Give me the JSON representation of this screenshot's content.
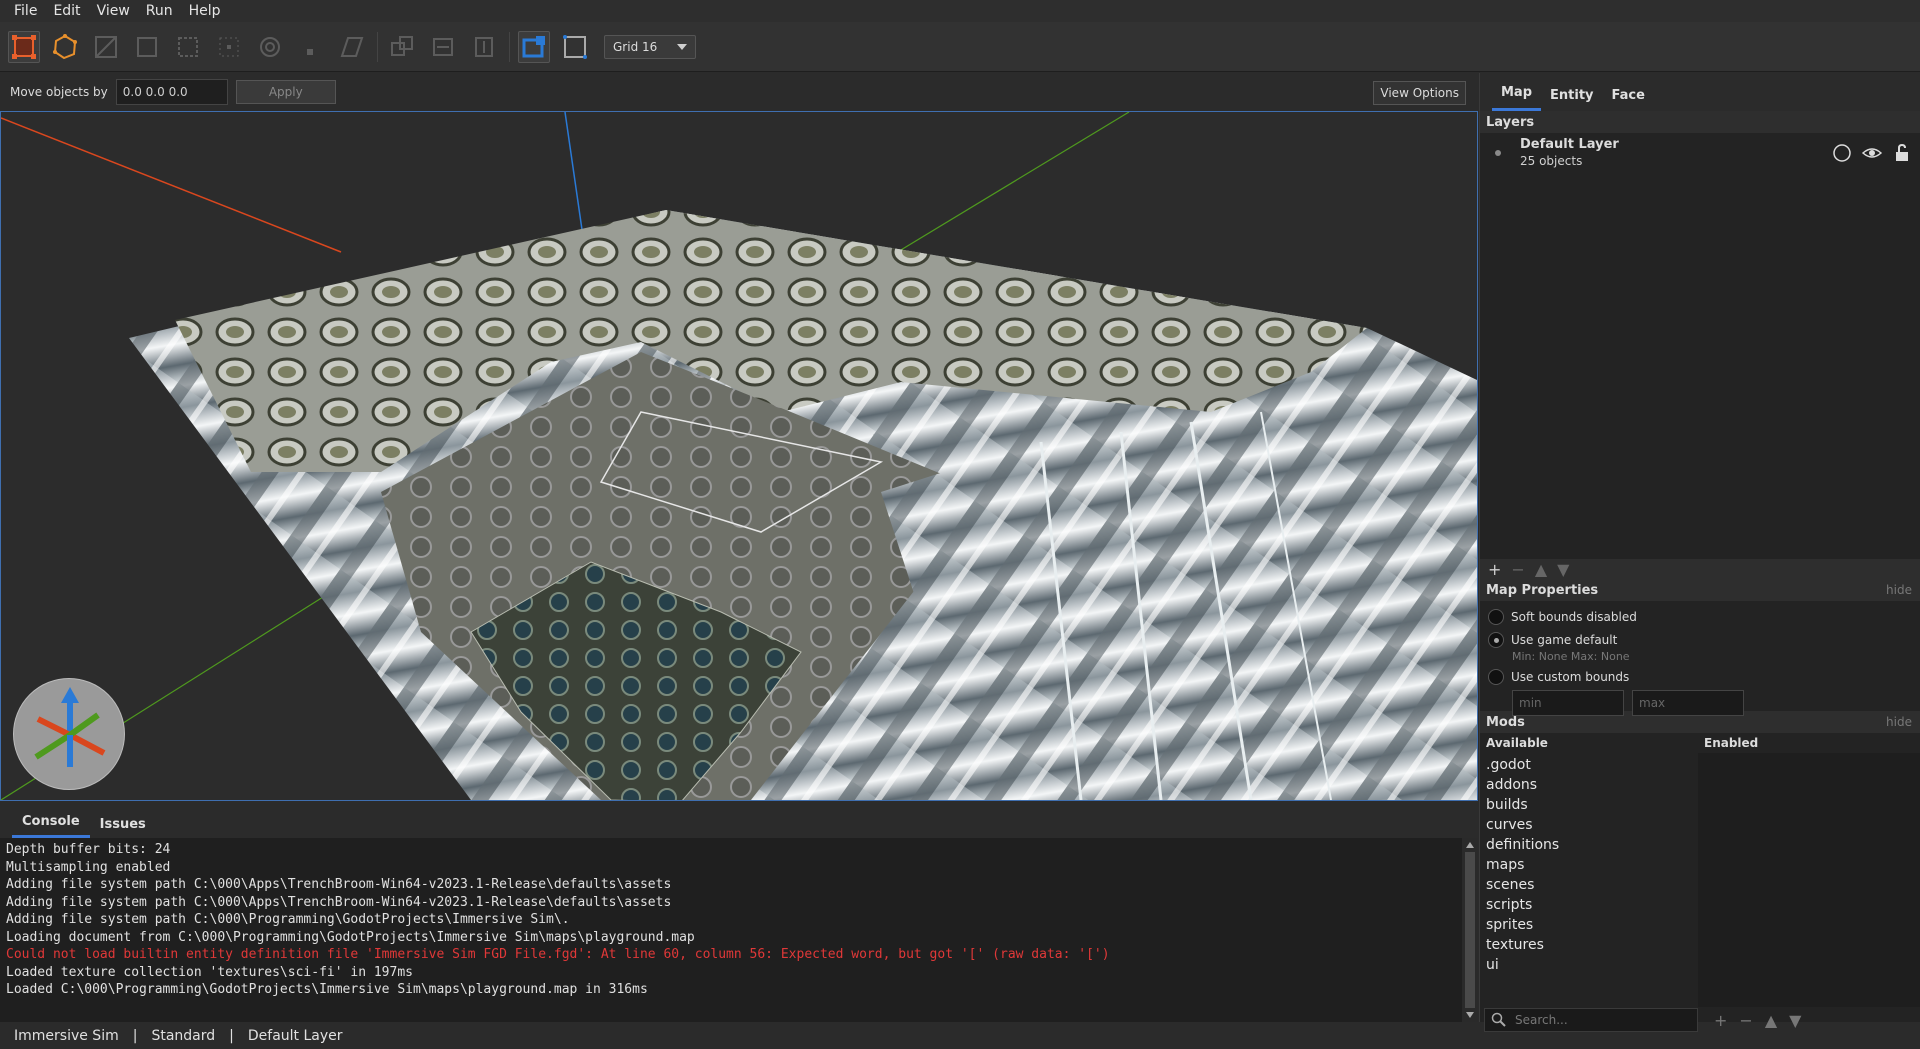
{
  "menu": [
    "File",
    "Edit",
    "View",
    "Run",
    "Help"
  ],
  "toolbar": {
    "tools": [
      "select-tool",
      "draw-brush-tool",
      "clip-tool",
      "vertex-tool",
      "edge-tool",
      "face-tool",
      "rotate-tool",
      "scale-tool",
      "shear-tool",
      "duplicate-tool",
      "flip-horizontal-tool",
      "flip-vertical-tool",
      "texture-lock-tool",
      "uv-lock-tool"
    ],
    "grid_label": "Grid 16"
  },
  "movebar": {
    "label": "Move objects by",
    "value": "0.0 0.0 0.0",
    "apply_label": "Apply",
    "view_options_label": "View Options"
  },
  "console": {
    "tabs": [
      "Console",
      "Issues"
    ],
    "lines": [
      {
        "text": "Depth buffer bits: 24",
        "error": false
      },
      {
        "text": "Multisampling enabled",
        "error": false
      },
      {
        "text": "Adding file system path C:\\000\\Apps\\TrenchBroom-Win64-v2023.1-Release\\defaults\\assets",
        "error": false
      },
      {
        "text": "Adding file system path C:\\000\\Apps\\TrenchBroom-Win64-v2023.1-Release\\defaults\\assets",
        "error": false
      },
      {
        "text": "Adding file system path C:\\000\\Programming\\GodotProjects\\Immersive Sim\\.",
        "error": false
      },
      {
        "text": "Loading document from C:\\000\\Programming\\GodotProjects\\Immersive Sim\\maps\\playground.map",
        "error": false
      },
      {
        "text": "Could not load builtin entity definition file 'Immersive Sim FGD File.fgd': At line 60, column 56: Expected word, but got '[' (raw data: '[')",
        "error": true
      },
      {
        "text": "Loaded texture collection 'textures\\sci-fi' in 197ms",
        "error": false
      },
      {
        "text": "Loaded C:\\000\\Programming\\GodotProjects\\Immersive Sim\\maps\\playground.map in 316ms",
        "error": false
      }
    ]
  },
  "status": [
    "Immersive Sim",
    "Standard",
    "Default Layer"
  ],
  "status_sep": "|",
  "inspector": {
    "tabs": [
      "Map",
      "Entity",
      "Face"
    ],
    "layers_title": "Layers",
    "layer": {
      "name": "Default Layer",
      "count": "25 objects"
    },
    "map_properties_title": "Map Properties",
    "hide_label": "hide",
    "bounds": {
      "opt_soft_disabled": "Soft bounds disabled",
      "opt_game_default": "Use game default",
      "game_default_info": "Min:  None  Max:  None",
      "opt_custom": "Use custom bounds",
      "min_placeholder": "min",
      "max_placeholder": "max",
      "selected": "Use game default"
    },
    "mods_title": "Mods",
    "available_label": "Available",
    "enabled_label": "Enabled",
    "available": [
      ".godot",
      "addons",
      "builds",
      "curves",
      "definitions",
      "maps",
      "scenes",
      "scripts",
      "sprites",
      "textures",
      "ui"
    ],
    "search_placeholder": "Search..."
  },
  "colors": {
    "accent": "#3b78d8",
    "error": "#e03838",
    "x_axis": "#d9471e",
    "y_axis": "#4f9a1e",
    "z_axis": "#2a7ad6"
  }
}
